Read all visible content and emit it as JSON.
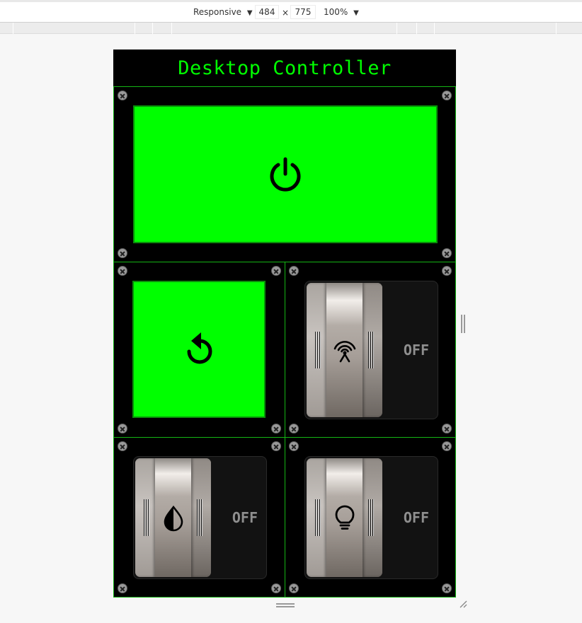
{
  "devtools": {
    "device_mode": "Responsive",
    "width": "484",
    "times": "×",
    "height": "775",
    "zoom": "100%",
    "dropdown_arrow": "▼"
  },
  "app": {
    "title": "Desktop Controller",
    "accent_color": "#00ff00",
    "power_button": {
      "icon": "power-icon"
    },
    "restart_button": {
      "icon": "restart-icon"
    },
    "toggles": [
      {
        "icon": "antenna-icon",
        "state": "OFF"
      },
      {
        "icon": "contrast-icon",
        "state": "OFF"
      },
      {
        "icon": "lightbulb-icon",
        "state": "OFF"
      }
    ]
  }
}
